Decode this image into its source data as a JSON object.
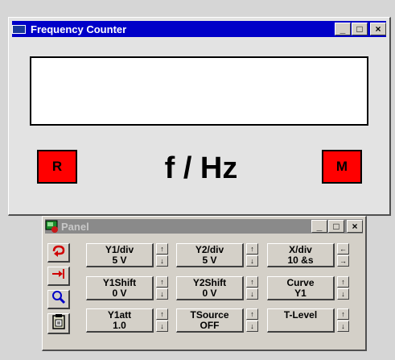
{
  "main_window": {
    "title": "Frequency Counter",
    "minimize": "_",
    "maximize": "□",
    "close": "×",
    "display_value": "",
    "r_label": "R",
    "unit_label": "f / Hz",
    "m_label": "M"
  },
  "panel": {
    "title": "Panel",
    "minimize": "_",
    "maximize": "□",
    "close": "×",
    "controls": [
      {
        "l1": "Y1/div",
        "l2": "5 V",
        "up": "↑",
        "down": "↓"
      },
      {
        "l1": "Y2/div",
        "l2": "5 V",
        "up": "↑",
        "down": "↓"
      },
      {
        "l1": "X/div",
        "l2": "10 &s",
        "up": "←",
        "down": "→"
      },
      {
        "l1": "Y1Shift",
        "l2": "0 V",
        "up": "↑",
        "down": "↓"
      },
      {
        "l1": "Y2Shift",
        "l2": "0 V",
        "up": "↑",
        "down": "↓"
      },
      {
        "l1": "Curve",
        "l2": "Y1",
        "up": "↑",
        "down": "↓"
      },
      {
        "l1": "Y1att",
        "l2": "1.0",
        "up": "↑",
        "down": "↓"
      },
      {
        "l1": "TSource",
        "l2": "OFF",
        "up": "↑",
        "down": "↓"
      },
      {
        "l1": "T-Level",
        "l2": "",
        "up": "↑",
        "down": "↓"
      }
    ]
  },
  "icons": [
    "cycle-arrow-icon",
    "arrow-to-bar-icon",
    "magnifier-icon",
    "clipboard-icon",
    "panel-app-icon"
  ],
  "colors": {
    "titlebar": "#0000c8",
    "red_button": "#ff0000",
    "window_bg": "#e3e3e3",
    "background": "#d6d6d6"
  }
}
